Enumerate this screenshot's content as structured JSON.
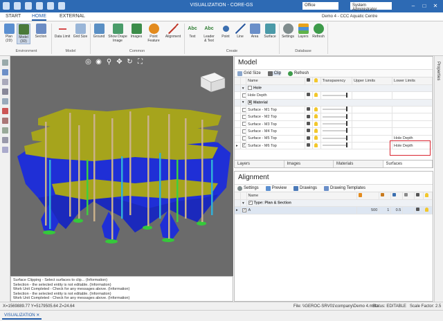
{
  "app": {
    "title": "VISUALIZATION - CORE-GS",
    "office": "Office",
    "user": "System Administrator",
    "project": "Demo 4 - CCC Aquatic Centre"
  },
  "tabs": [
    "START",
    "HOME",
    "EXTERNAL"
  ],
  "ribbon": {
    "buttons": {
      "plan": "Plan\n(2D)",
      "model": "Model\n(3D)",
      "section": "Section",
      "data_limit": "Data Limit",
      "grid_size": "Grid Size",
      "ground": "Ground",
      "show_drape": "Show Drape\nImage",
      "images": "Images",
      "point_feature": "Point\nFeature",
      "alignment": "Alignment",
      "text": "Text",
      "leader_text": "Leader\n& Text",
      "point": "Point",
      "line": "Line",
      "area": "Area",
      "surface": "Surface",
      "settings": "Settings",
      "layers": "Layers",
      "refresh": "Refresh"
    },
    "groups": {
      "environment": "Environment",
      "model": "Model",
      "common": "Common",
      "create": "Create",
      "database": "Database"
    }
  },
  "viewport": {
    "nav_icons": [
      "target-icon",
      "globe-icon",
      "zoom-icon",
      "pan-icon",
      "rotate-icon",
      "fit-icon"
    ]
  },
  "messages": [
    "Surface Clipping - Select surfaces to clip... (Information)",
    "Selection - the selected entity is not editable. (Information)",
    "Work Unit Completed - Check for any messages above. (Information)",
    "Selection - the selected entity is not editable. (Information)",
    "Work Unit Completed - Check for any messages above. (Information)"
  ],
  "status": {
    "coords": "X=1569889.77  Y=5179505.64  Z=24.64",
    "file": "File: \\\\GEROC-SRV01\\company\\Demo 4.mdlz",
    "edit_status": "Status: EDITABLE",
    "scale": "Scale Factor: 2.5"
  },
  "bottom_tab": "VISUALIZATION",
  "properties_label": "Properties",
  "model_panel": {
    "title": "Model",
    "tools": {
      "grid_size": "Grid Size",
      "clip": "Clip",
      "refresh": "Refresh"
    },
    "columns": [
      "Name",
      "Transparency",
      "Upper Limits",
      "Lower Limits"
    ],
    "rows": [
      {
        "kind": "group",
        "name": "Hole"
      },
      {
        "kind": "item",
        "name": "Hole Depth",
        "upper": "",
        "lower": ""
      },
      {
        "kind": "group",
        "name": "Material"
      },
      {
        "kind": "item",
        "name": "Surface - M1 Top",
        "upper": "",
        "lower": ""
      },
      {
        "kind": "item",
        "name": "Surface - M2 Top",
        "upper": "",
        "lower": ""
      },
      {
        "kind": "item",
        "name": "Surface - M3 Top",
        "upper": "",
        "lower": ""
      },
      {
        "kind": "item",
        "name": "Surface - M4 Top",
        "upper": "",
        "lower": ""
      },
      {
        "kind": "item",
        "name": "Surface - M5 Top",
        "upper": "",
        "lower": "Hole Depth"
      },
      {
        "kind": "item",
        "name": "Surface - M6 Top",
        "upper": "",
        "lower": "Hole Depth"
      }
    ],
    "tabs": [
      "Layers",
      "Images",
      "Materials",
      "Surfaces"
    ]
  },
  "alignment_panel": {
    "title": "Alignment",
    "tools": {
      "settings": "Settings",
      "preview": "Preview",
      "drawings": "Drawings",
      "drawing_templates": "Drawing Templates"
    },
    "columns": [
      "Name"
    ],
    "group": "Type: Plan & Section",
    "rows": [
      {
        "name": "A",
        "v1": "500",
        "v2": "1",
        "v3": "0.5"
      }
    ]
  },
  "colors": {
    "titlebar": "#2d6ab4",
    "surface_olive": "#a6a41c",
    "surface_blue": "#1f2fd6",
    "highlight": "#d9232e"
  }
}
